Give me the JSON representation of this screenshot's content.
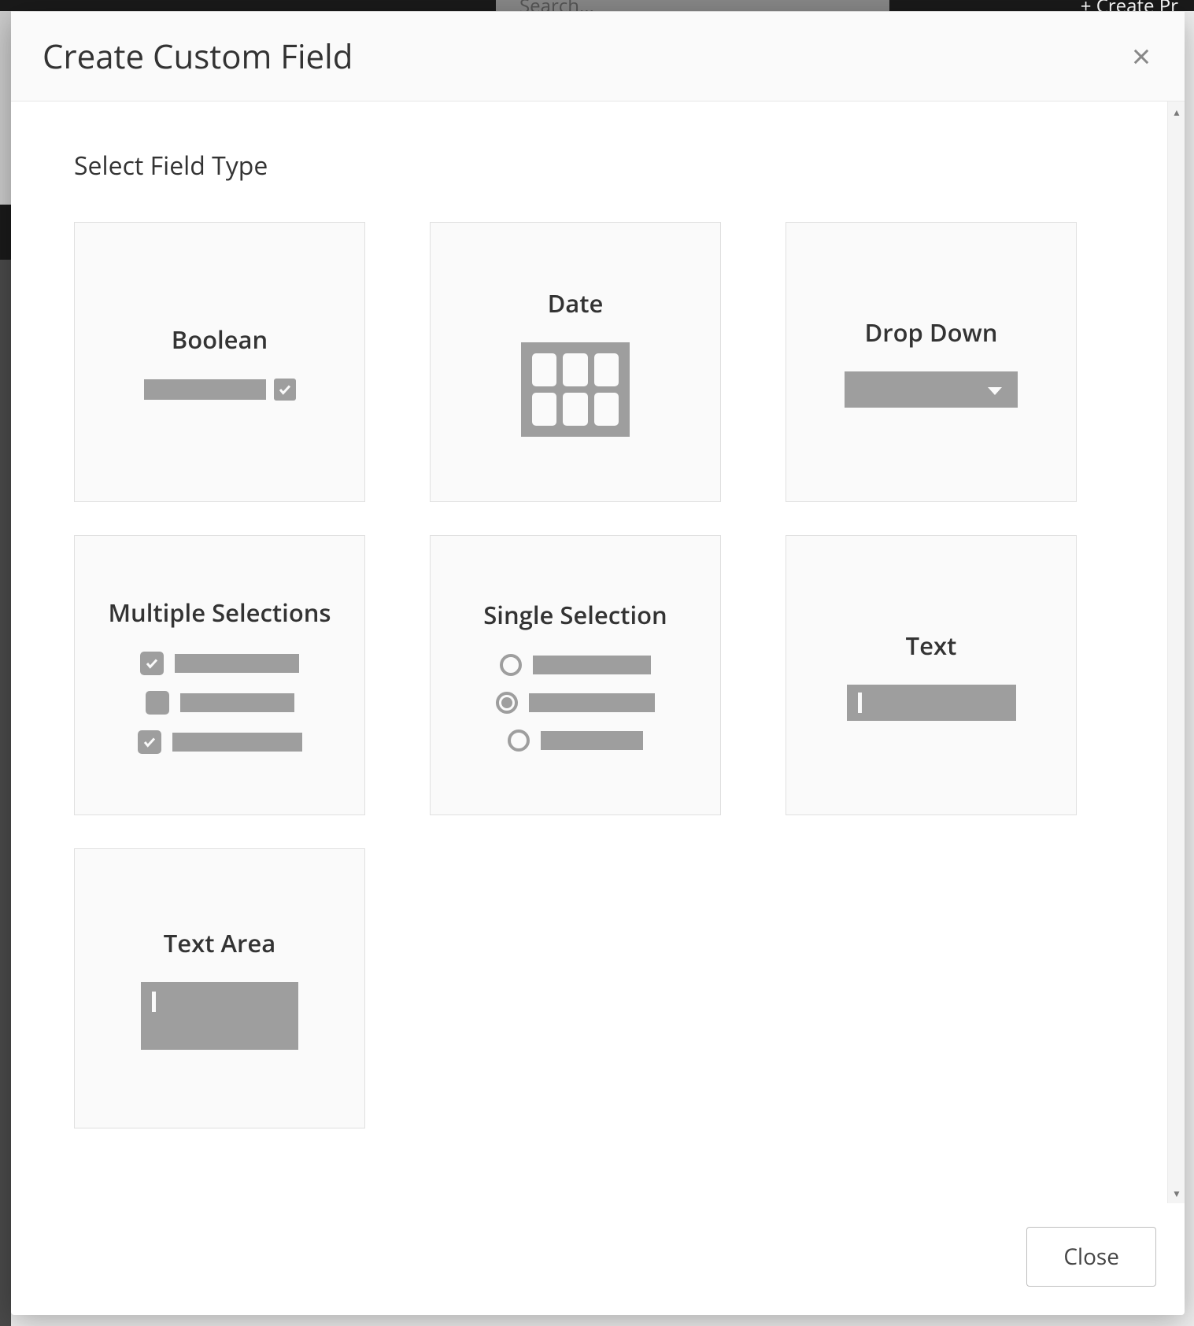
{
  "background": {
    "search_placeholder": "Search...",
    "create_label": "+  Create Pr"
  },
  "modal": {
    "title": "Create Custom Field",
    "section_title": "Select Field Type",
    "close_button": "Close",
    "field_types": {
      "boolean": "Boolean",
      "date": "Date",
      "dropdown": "Drop Down",
      "multiple": "Multiple Selections",
      "single": "Single Selection",
      "text": "Text",
      "textarea": "Text Area"
    }
  }
}
